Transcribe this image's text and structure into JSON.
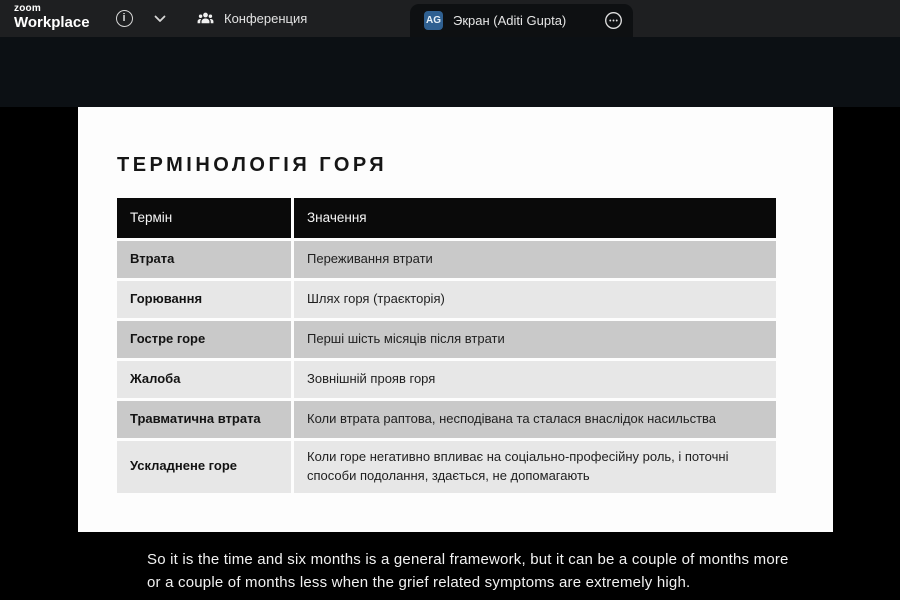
{
  "topbar": {
    "logo_line1": "zoom",
    "logo_line2": "Workplace",
    "info_glyph": "i",
    "conference_tab_label": "Конференция",
    "screen_tab_label": "Экран (Aditi Gupta)",
    "avatar_initials": "AG",
    "icons": [
      "info-icon",
      "chevron-down-icon",
      "people-icon",
      "ellipsis-icon"
    ]
  },
  "slide": {
    "title": "ТЕРМІНОЛОГІЯ ГОРЯ",
    "table": {
      "headers": [
        "Термін",
        "Значення"
      ],
      "rows": [
        [
          "Втрата",
          "Переживання втрати"
        ],
        [
          "Горювання",
          "Шлях горя (траєкторія)"
        ],
        [
          "Гостре горе",
          "Перші шість місяців після втрати"
        ],
        [
          "Жалоба",
          "Зовнішній прояв горя"
        ],
        [
          "Травматична втрата",
          "Коли втрата раптова, несподівана та сталася внаслідок насильства"
        ],
        [
          "Ускладнене горе",
          "Коли горе негативно впливає на соціально-професійну роль, і поточні способи подолання, здається, не допомагають"
        ]
      ]
    }
  },
  "caption": {
    "line1": "So it is the time and six months is a general framework, but it can be a couple of months more",
    "line2": "or a couple of months less when the grief related symptoms are extremely high."
  },
  "colors": {
    "topbar_bg": "#1e1f21",
    "active_tab_bg": "#0e1012",
    "avatar_bg": "#2f6091",
    "stage_bg": "#000000",
    "slide_bg": "#fdfdfd",
    "table_header_bg": "#0a0a0a",
    "row_odd_bg": "#c9c9c9",
    "row_even_bg": "#e7e7e7"
  }
}
